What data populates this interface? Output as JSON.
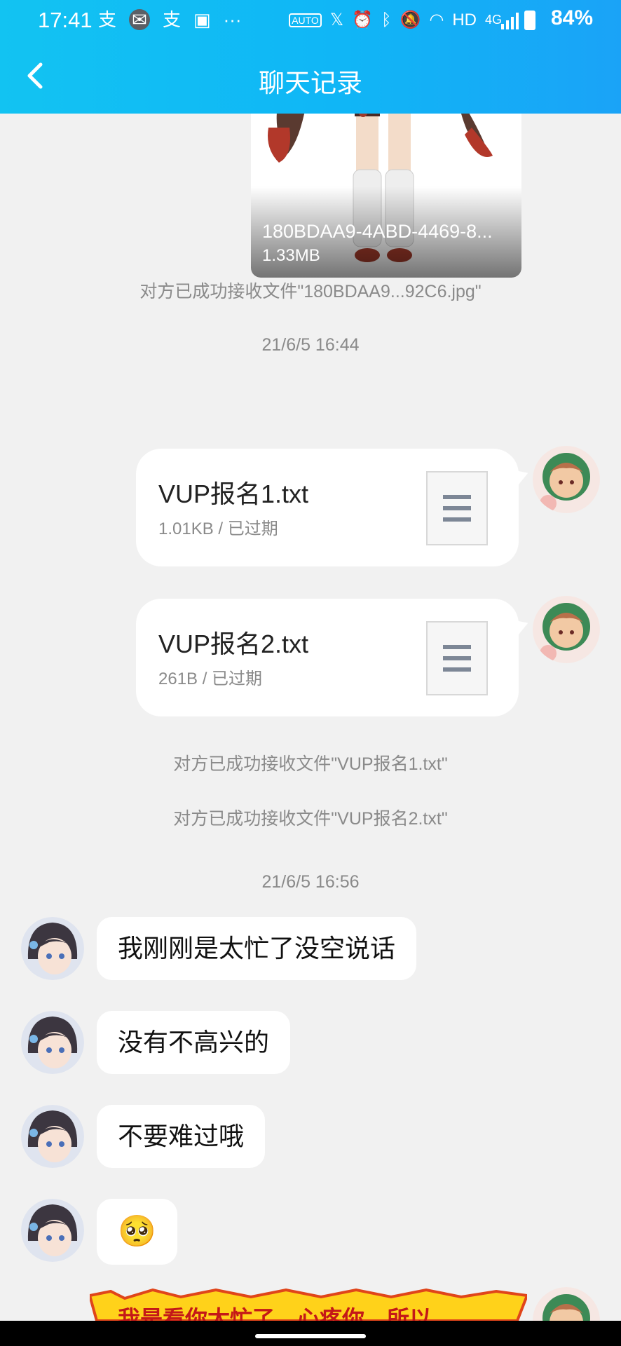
{
  "status_bar": {
    "time": "17:41",
    "network": "HD",
    "mobile": "4G",
    "battery": "84%"
  },
  "header": {
    "title": "聊天记录"
  },
  "image_message": {
    "filename": "180BDAA9-4ABD-4469-8...",
    "size": "1.33MB"
  },
  "system_messages": {
    "received_image": "对方已成功接收文件\"180BDAA9...92C6.jpg\"",
    "time_1": "21/6/5 16:44",
    "received_file_1": "对方已成功接收文件\"VUP报名1.txt\"",
    "received_file_2": "对方已成功接收文件\"VUP报名2.txt\"",
    "time_2": "21/6/5 16:56"
  },
  "file_messages": [
    {
      "name": "VUP报名1.txt",
      "meta": "1.01KB / 已过期"
    },
    {
      "name": "VUP报名2.txt",
      "meta": "261B / 已过期"
    }
  ],
  "text_messages": [
    {
      "text": "我刚刚是太忙了没空说话"
    },
    {
      "text": "没有不高兴的"
    },
    {
      "text": "不要难过哦"
    },
    {
      "text": "🥺"
    }
  ],
  "sticker_text": "我是看你太忙了，心疼你，所以",
  "colors": {
    "header_start": "#12c3f2",
    "header_end": "#1aa3f7",
    "background": "#f1f1f1",
    "bubble": "#ffffff",
    "system_text": "#8a8a8a"
  }
}
